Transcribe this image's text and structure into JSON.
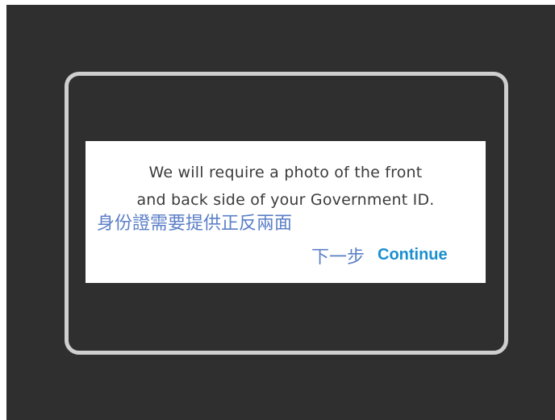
{
  "dialog": {
    "message_line1": "We will require a photo of the front",
    "message_line2": "and back side of your Government ID.",
    "chinese_note": "身份證需要提供正反兩面",
    "chinese_next": "下一步",
    "continue_label": "Continue"
  },
  "colors": {
    "background": "#2f2f2f",
    "frame_border": "#cfcfcf",
    "card": "#ffffff",
    "message_text": "#3c3c3c",
    "chinese_text": "#5b7fc8",
    "continue_link": "#1a8fd0"
  }
}
